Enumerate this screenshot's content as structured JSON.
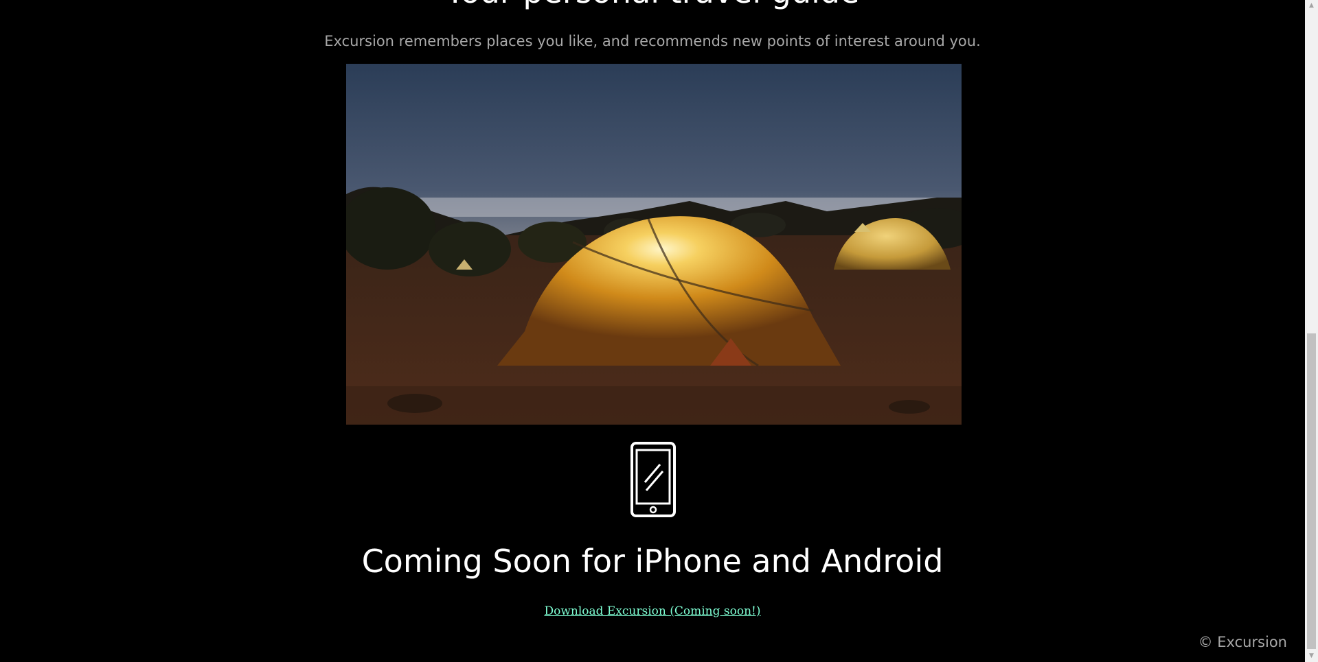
{
  "hero": {
    "title": "Your personal travel guide",
    "tagline": "Excursion remembers places you like, and recommends new points of interest around you."
  },
  "image": {
    "subject": "glowing-tents-at-night",
    "colors": {
      "sky_top": "#2b3d57",
      "sky_bottom": "#8a8c94",
      "ground": "#4a2a1a",
      "tent_glow": "#f2c64a",
      "tent_body": "#c78a1c"
    }
  },
  "phone": {
    "icon": "smartphone-icon"
  },
  "headline": "Coming Soon for iPhone and Android",
  "download": {
    "label": "Download Excursion (Coming soon!)",
    "color": "#7fffd4"
  },
  "footer": {
    "copyright": "© Excursion"
  },
  "scrollbar": {
    "up_arrow": "▲",
    "down_arrow": "▼"
  }
}
